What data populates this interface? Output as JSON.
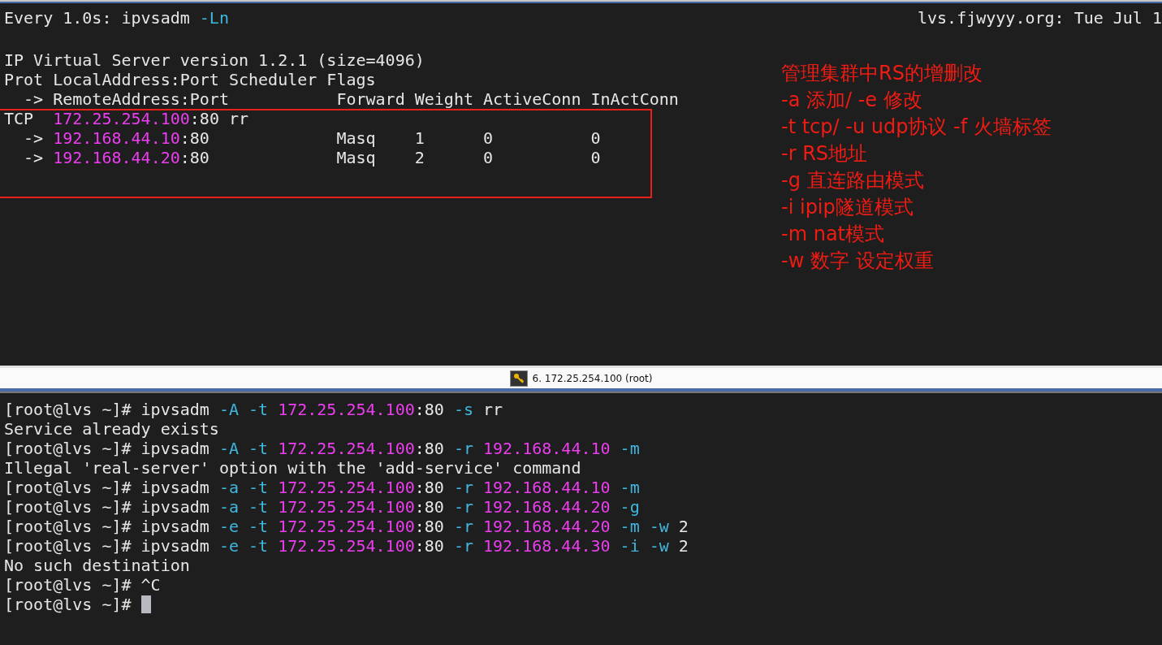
{
  "top_pane": {
    "header": {
      "left": [
        {
          "kind": "plain",
          "text": "Every 1.0s: ipvsadm "
        },
        {
          "kind": "option",
          "text": "-Ln"
        }
      ],
      "right": "lvs.fjwyyy.org: Tue Jul 1"
    },
    "lines": [
      {
        "segments": [
          {
            "kind": "plain",
            "text": "IP Virtual Server version 1.2.1 (size=4096)"
          }
        ]
      },
      {
        "segments": [
          {
            "kind": "plain",
            "text": "Prot LocalAddress:Port Scheduler Flags"
          }
        ]
      },
      {
        "segments": [
          {
            "kind": "plain",
            "text": "  -> RemoteAddress:Port           Forward Weight ActiveConn InActConn"
          }
        ]
      },
      {
        "segments": [
          {
            "kind": "plain",
            "text": "TCP  "
          },
          {
            "kind": "ip",
            "text": "172.25.254.100"
          },
          {
            "kind": "plain",
            "text": ":80 rr"
          }
        ]
      },
      {
        "segments": [
          {
            "kind": "plain",
            "text": "  -> "
          },
          {
            "kind": "ip",
            "text": "192.168.44.10"
          },
          {
            "kind": "plain",
            "text": ":80             Masq    1      0          0"
          }
        ]
      },
      {
        "segments": [
          {
            "kind": "plain",
            "text": "  -> "
          },
          {
            "kind": "ip",
            "text": "192.168.44.20"
          },
          {
            "kind": "plain",
            "text": ":80             Masq    2      0          0"
          }
        ]
      }
    ],
    "annotations": [
      "管理集群中RS的增删改",
      "-a 添加/ -e 修改",
      "-t tcp/ -u udp协议 -f 火墙标签",
      "-r RS地址",
      "-g 直连路由模式",
      "-i ipip隧道模式",
      "-m nat模式",
      "-w 数字 设定权重"
    ]
  },
  "tab_bar": {
    "label": "6. 172.25.254.100 (root)"
  },
  "bottom_pane": {
    "cursor": true,
    "lines": [
      {
        "segments": [
          {
            "kind": "plain",
            "text": "[root@lvs ~]# ipvsadm "
          },
          {
            "kind": "option",
            "text": "-A -t "
          },
          {
            "kind": "ip",
            "text": "172.25.254.100"
          },
          {
            "kind": "plain",
            "text": ":80 "
          },
          {
            "kind": "option",
            "text": "-s"
          },
          {
            "kind": "plain",
            "text": " rr"
          }
        ]
      },
      {
        "segments": [
          {
            "kind": "plain",
            "text": "Service already exists"
          }
        ]
      },
      {
        "segments": [
          {
            "kind": "plain",
            "text": "[root@lvs ~]# ipvsadm "
          },
          {
            "kind": "option",
            "text": "-A -t "
          },
          {
            "kind": "ip",
            "text": "172.25.254.100"
          },
          {
            "kind": "plain",
            "text": ":80 "
          },
          {
            "kind": "option",
            "text": "-r "
          },
          {
            "kind": "ip",
            "text": "192.168.44.10 "
          },
          {
            "kind": "option",
            "text": "-m"
          }
        ]
      },
      {
        "segments": [
          {
            "kind": "plain",
            "text": "Illegal 'real-server' option with the 'add-service' command"
          }
        ]
      },
      {
        "segments": [
          {
            "kind": "plain",
            "text": "[root@lvs ~]# ipvsadm "
          },
          {
            "kind": "option",
            "text": "-a -t "
          },
          {
            "kind": "ip",
            "text": "172.25.254.100"
          },
          {
            "kind": "plain",
            "text": ":80 "
          },
          {
            "kind": "option",
            "text": "-r "
          },
          {
            "kind": "ip",
            "text": "192.168.44.10 "
          },
          {
            "kind": "option",
            "text": "-m"
          }
        ]
      },
      {
        "segments": [
          {
            "kind": "plain",
            "text": "[root@lvs ~]# ipvsadm "
          },
          {
            "kind": "option",
            "text": "-a -t "
          },
          {
            "kind": "ip",
            "text": "172.25.254.100"
          },
          {
            "kind": "plain",
            "text": ":80 "
          },
          {
            "kind": "option",
            "text": "-r "
          },
          {
            "kind": "ip",
            "text": "192.168.44.20 "
          },
          {
            "kind": "option",
            "text": "-g"
          }
        ]
      },
      {
        "segments": [
          {
            "kind": "plain",
            "text": "[root@lvs ~]# ipvsadm "
          },
          {
            "kind": "option",
            "text": "-e -t "
          },
          {
            "kind": "ip",
            "text": "172.25.254.100"
          },
          {
            "kind": "plain",
            "text": ":80 "
          },
          {
            "kind": "option",
            "text": "-r "
          },
          {
            "kind": "ip",
            "text": "192.168.44.20 "
          },
          {
            "kind": "option",
            "text": "-m -w"
          },
          {
            "kind": "plain",
            "text": " 2"
          }
        ]
      },
      {
        "segments": [
          {
            "kind": "plain",
            "text": "[root@lvs ~]# ipvsadm "
          },
          {
            "kind": "option",
            "text": "-e -t "
          },
          {
            "kind": "ip",
            "text": "172.25.254.100"
          },
          {
            "kind": "plain",
            "text": ":80 "
          },
          {
            "kind": "option",
            "text": "-r "
          },
          {
            "kind": "ip",
            "text": "192.168.44.30 "
          },
          {
            "kind": "option",
            "text": "-i -w"
          },
          {
            "kind": "plain",
            "text": " 2"
          }
        ]
      },
      {
        "segments": [
          {
            "kind": "plain",
            "text": "No such destination"
          }
        ]
      },
      {
        "segments": [
          {
            "kind": "plain",
            "text": "[root@lvs ~]# ^C"
          }
        ]
      },
      {
        "segments": [
          {
            "kind": "plain",
            "text": "[root@lvs ~]# "
          }
        ]
      }
    ]
  }
}
